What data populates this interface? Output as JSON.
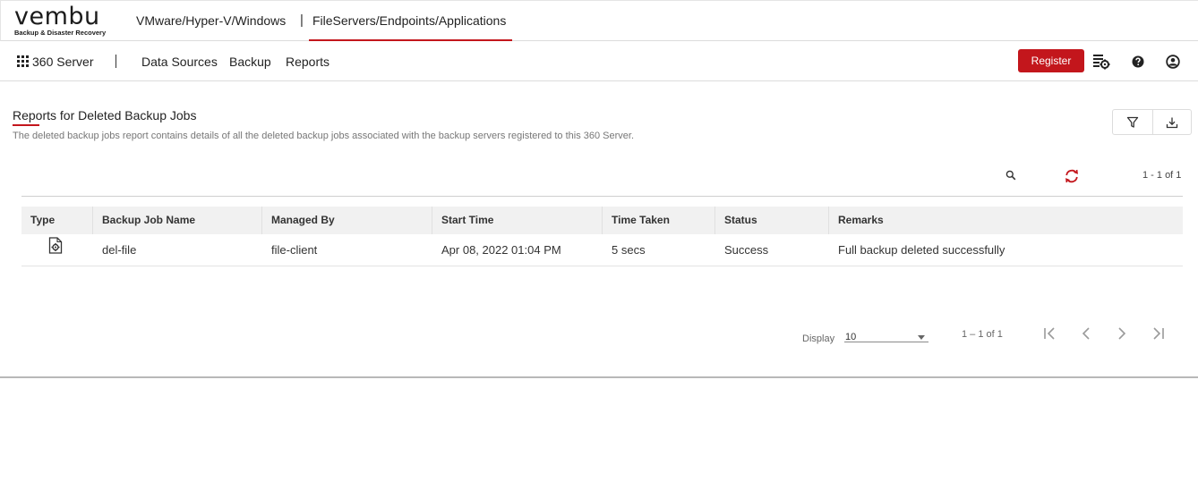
{
  "header": {
    "logo_word": "vembu",
    "logo_tagline": "Backup & Disaster Recovery",
    "product_tabs": [
      {
        "label": "VMware/Hyper-V/Windows",
        "active": false
      },
      {
        "label": "FileServers/Endpoints/Applications",
        "active": true
      }
    ],
    "tab_separator": "|"
  },
  "nav": {
    "brand": "360 Server",
    "brand_icon": "apps-grid-icon",
    "items": [
      "Data Sources",
      "Backup",
      "Reports"
    ],
    "register_label": "Register",
    "icons": [
      "settings-list-icon",
      "help-icon",
      "user-icon"
    ]
  },
  "page": {
    "title": "Reports for Deleted Backup Jobs",
    "description": "The deleted backup jobs report contains details of all the deleted backup jobs associated with the backup servers registered to this 360 Server.",
    "actions": [
      "filter-icon",
      "download-icon"
    ]
  },
  "toolbar": {
    "count": "1 - 1 of 1",
    "icons": [
      "search-icon",
      "refresh-icon"
    ]
  },
  "table": {
    "columns": [
      "Type",
      "Backup Job Name",
      "Managed By",
      "Start Time",
      "Time Taken",
      "Status",
      "Remarks"
    ],
    "rows": [
      {
        "type_icon": "file-backup-icon",
        "name": "del-file",
        "managed_by": "file-client",
        "start_time": "Apr 08, 2022 01:04 PM",
        "time_taken": "5 secs",
        "status": "Success",
        "remarks": "Full backup deleted successfully"
      }
    ]
  },
  "pagination": {
    "display_label": "Display",
    "page_size": "10",
    "range": "1 – 1 of 1",
    "icons": [
      "first-page-icon",
      "prev-page-icon",
      "next-page-icon",
      "last-page-icon"
    ]
  },
  "colors": {
    "accent": "#c3161c",
    "header_bg": "#f1f1f1"
  }
}
